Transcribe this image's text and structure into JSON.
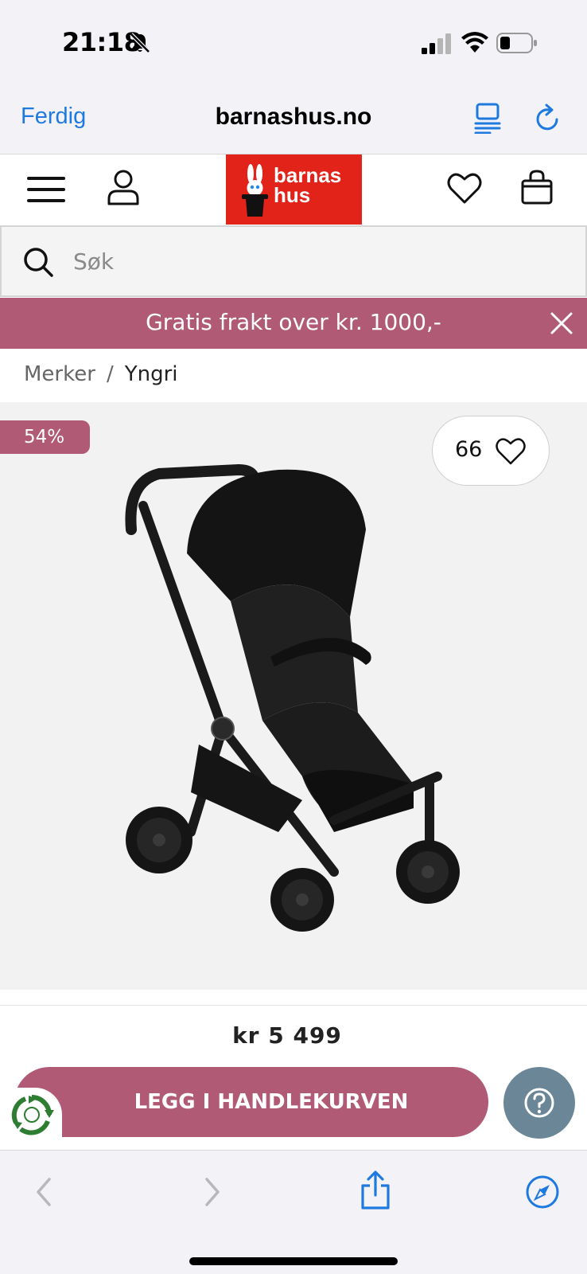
{
  "status_bar": {
    "time": "21:18"
  },
  "browser": {
    "done_label": "Ferdig",
    "url": "barnashus.no"
  },
  "header": {
    "logo_line1": "barnas",
    "logo_line2": "hus"
  },
  "search": {
    "placeholder": "Søk"
  },
  "promo": {
    "text": "Gratis frakt over kr. 1000,-"
  },
  "breadcrumb": {
    "parent": "Merker",
    "separator": "/",
    "current": "Yngri"
  },
  "product": {
    "discount_badge": "54%",
    "favorite_count": "66",
    "price": "kr 5 499",
    "add_to_cart_label": "LEGG I HANDLEKURVEN"
  },
  "colors": {
    "brand_pink": "#b05a76",
    "logo_red": "#e2231a",
    "ios_blue": "#1f7ae0",
    "help_button": "#6b8797"
  },
  "icons": [
    "bell-slash-icon",
    "signal-icon",
    "wifi-icon",
    "battery-icon",
    "reader-mode-icon",
    "reload-icon",
    "menu-icon",
    "account-icon",
    "heart-icon",
    "shopping-bag-icon",
    "search-icon",
    "close-icon",
    "recycle-icon",
    "help-icon",
    "back-arrow-icon",
    "forward-arrow-icon",
    "share-icon",
    "compass-icon"
  ]
}
